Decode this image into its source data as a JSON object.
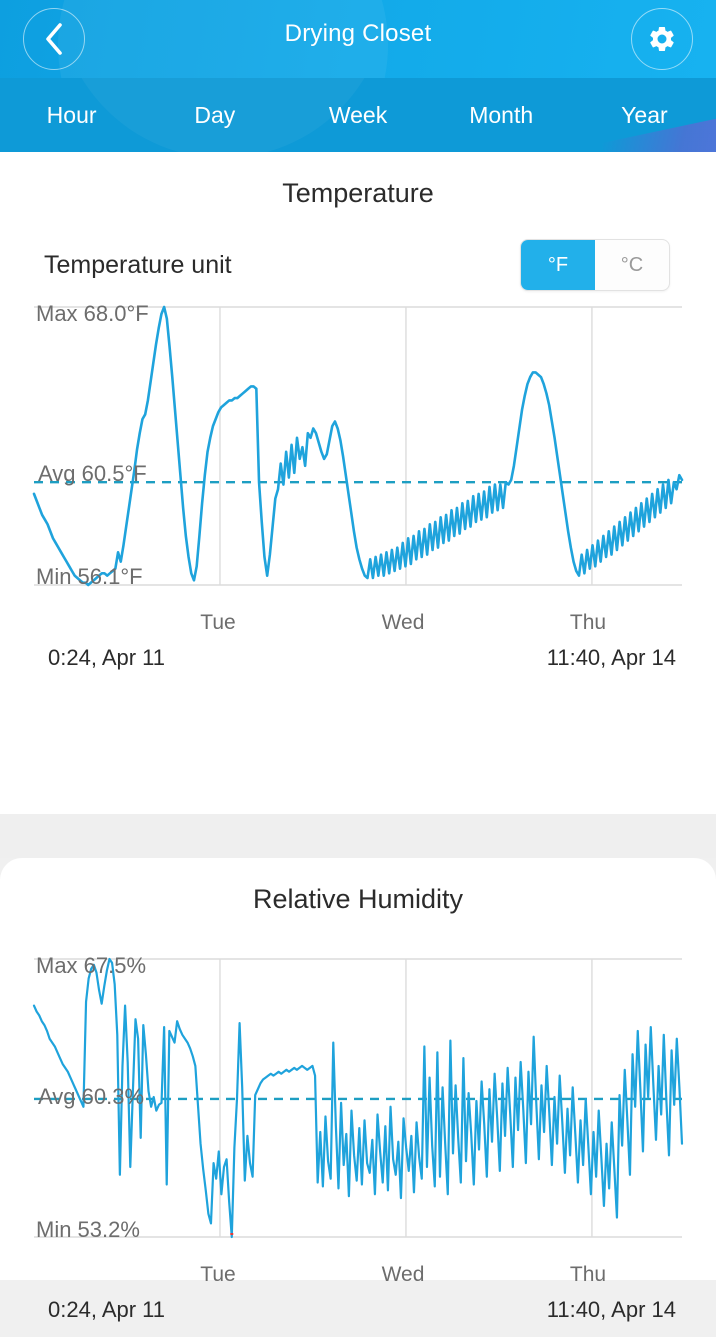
{
  "header": {
    "title": "Drying Closet",
    "back_icon": "chevron-left-icon",
    "settings_icon": "gear-icon"
  },
  "tabs": [
    {
      "label": "Hour",
      "active": false
    },
    {
      "label": "Day",
      "active": true
    },
    {
      "label": "Week",
      "active": false
    },
    {
      "label": "Month",
      "active": false
    },
    {
      "label": "Year",
      "active": false
    }
  ],
  "temperature_card": {
    "title": "Temperature",
    "unit_label": "Temperature unit",
    "unit_options": [
      {
        "label": "°F",
        "selected": true
      },
      {
        "label": "°C",
        "selected": false
      }
    ],
    "max_label": "Max 68.0°F",
    "avg_label": "Avg 60.5°F",
    "min_label": "Min 56.1°F",
    "range_start": "0:24,  Apr 11",
    "range_end": "11:40,  Apr 14",
    "day_ticks": [
      "Tue",
      "Wed",
      "Thu"
    ]
  },
  "humidity_card": {
    "title": "Relative Humidity",
    "max_label": "Max 67.5%",
    "avg_label": "Avg 60.3%",
    "min_label": "Min 53.2%",
    "range_start": "0:24,  Apr 11",
    "range_end": "11:40,  Apr 14",
    "day_ticks": [
      "Tue",
      "Wed",
      "Thu"
    ]
  },
  "colors": {
    "accent": "#22b0ea",
    "line": "#1fa3dc",
    "header_blue": "#12a9e8",
    "tab_blue": "#0e9ad7",
    "alert_red": "#e23b3b",
    "grid": "#dcdcdc"
  },
  "chart_data": [
    {
      "type": "line",
      "title": "Temperature",
      "ylabel": "°F",
      "xlabel": "",
      "grid": true,
      "legend": "none",
      "unit": "°F",
      "ylim": [
        56.1,
        68.0
      ],
      "max": 68.0,
      "avg": 60.5,
      "min": 56.1,
      "avg_line": 60.5,
      "x_start": "0:24, Apr 11",
      "x_end": "11:40, Apr 14",
      "tick_labels": [
        "Tue",
        "Wed",
        "Thu"
      ],
      "tick_positions_frac": [
        0.287,
        0.574,
        0.861
      ],
      "values": [
        60.0,
        59.7,
        59.4,
        59.1,
        58.9,
        58.7,
        58.4,
        58.1,
        57.9,
        57.7,
        57.5,
        57.3,
        57.1,
        56.9,
        56.7,
        56.5,
        56.4,
        56.3,
        56.2,
        56.2,
        56.1,
        56.2,
        56.3,
        56.4,
        56.5,
        56.6,
        56.6,
        56.5,
        56.6,
        56.7,
        56.8,
        57.5,
        57.1,
        57.8,
        58.6,
        59.4,
        60.2,
        61.0,
        61.9,
        62.6,
        63.2,
        63.4,
        64.0,
        64.8,
        65.6,
        66.4,
        67.1,
        67.7,
        68.0,
        67.5,
        66.3,
        65.0,
        63.6,
        62.2,
        60.8,
        59.4,
        58.2,
        57.3,
        56.6,
        56.3,
        56.9,
        58.2,
        59.6,
        60.8,
        61.8,
        62.4,
        62.9,
        63.2,
        63.5,
        63.7,
        63.8,
        63.9,
        64.0,
        64.0,
        64.1,
        64.1,
        64.2,
        64.3,
        64.4,
        64.5,
        64.6,
        64.6,
        64.5,
        60.5,
        58.8,
        57.3,
        56.5,
        57.4,
        58.6,
        59.8,
        60.2,
        61.3,
        60.4,
        61.8,
        60.7,
        62.1,
        60.9,
        62.4,
        61.5,
        62.0,
        61.2,
        62.6,
        62.4,
        62.8,
        62.6,
        62.2,
        61.8,
        61.5,
        61.7,
        62.3,
        62.9,
        63.1,
        62.8,
        62.3,
        61.6,
        60.8,
        60.0,
        59.2,
        58.4,
        57.7,
        57.2,
        56.8,
        56.5,
        56.4,
        57.2,
        56.4,
        57.3,
        56.5,
        57.4,
        56.5,
        57.5,
        56.6,
        57.6,
        56.7,
        57.7,
        56.8,
        57.9,
        56.9,
        58.1,
        57.0,
        58.2,
        57.2,
        58.4,
        57.3,
        58.5,
        57.4,
        58.7,
        57.6,
        58.8,
        57.7,
        59.0,
        57.9,
        59.1,
        58.0,
        59.3,
        58.2,
        59.4,
        58.3,
        59.6,
        58.5,
        59.7,
        58.6,
        59.9,
        58.8,
        60.0,
        58.9,
        60.1,
        59.0,
        60.3,
        59.2,
        60.4,
        59.3,
        60.4,
        59.4,
        60.5,
        60.4,
        60.6,
        61.2,
        62.0,
        62.8,
        63.6,
        64.2,
        64.7,
        65.0,
        65.2,
        65.2,
        65.1,
        65.0,
        64.7,
        64.3,
        63.8,
        63.1,
        62.4,
        61.6,
        60.8,
        60.0,
        59.2,
        58.4,
        57.7,
        57.1,
        56.7,
        56.5,
        57.4,
        56.6,
        57.6,
        56.8,
        57.8,
        56.9,
        58.0,
        57.1,
        58.2,
        57.3,
        58.4,
        57.4,
        58.6,
        57.6,
        58.8,
        57.8,
        59.0,
        58.0,
        59.2,
        58.2,
        59.4,
        58.4,
        59.6,
        58.6,
        59.8,
        58.8,
        60.0,
        59.0,
        60.2,
        59.2,
        60.4,
        59.4,
        60.6,
        59.6,
        60.5,
        60.2,
        60.8,
        60.6
      ]
    },
    {
      "type": "line",
      "title": "Relative Humidity",
      "ylabel": "%",
      "xlabel": "",
      "grid": true,
      "legend": "none",
      "unit": "%",
      "ylim": [
        53.2,
        67.5
      ],
      "max": 67.5,
      "avg": 60.3,
      "min": 53.2,
      "avg_line": 60.3,
      "x_start": "0:24, Apr 11",
      "x_end": "11:40, Apr 14",
      "tick_labels": [
        "Tue",
        "Wed",
        "Thu"
      ],
      "tick_positions_frac": [
        0.287,
        0.574,
        0.861
      ],
      "values": [
        65.1,
        64.8,
        64.6,
        64.3,
        64.1,
        63.8,
        63.4,
        63.2,
        63.0,
        62.7,
        62.4,
        62.1,
        61.9,
        61.7,
        61.4,
        61.1,
        60.8,
        60.5,
        60.2,
        59.9,
        65.3,
        66.5,
        67.0,
        67.2,
        66.8,
        65.9,
        65.2,
        66.1,
        66.9,
        67.5,
        67.3,
        66.2,
        63.6,
        56.4,
        62.0,
        65.1,
        62.2,
        56.8,
        60.7,
        64.4,
        63.4,
        58.3,
        64.1,
        62.6,
        60.7,
        59.9,
        60.4,
        59.7,
        60.0,
        60.1,
        64.0,
        55.9,
        63.8,
        63.5,
        63.2,
        64.3,
        63.9,
        63.6,
        63.4,
        63.2,
        62.9,
        62.5,
        62.0,
        60.0,
        58.0,
        56.7,
        55.6,
        54.4,
        53.9,
        57.0,
        56.2,
        57.6,
        55.4,
        56.8,
        57.2,
        55.0,
        53.2,
        57.8,
        60.3,
        64.2,
        60.9,
        56.1,
        58.4,
        57.0,
        56.3,
        60.5,
        60.8,
        61.1,
        61.3,
        61.4,
        61.5,
        61.6,
        61.5,
        61.6,
        61.7,
        61.6,
        61.7,
        61.8,
        61.7,
        61.8,
        61.9,
        61.8,
        61.9,
        62.0,
        61.9,
        61.8,
        61.9,
        62.0,
        61.5,
        56.0,
        58.6,
        55.8,
        59.4,
        57.1,
        56.2,
        63.2,
        58.9,
        55.7,
        60.1,
        56.9,
        58.5,
        55.3,
        59.7,
        57.4,
        56.1,
        58.8,
        55.9,
        59.2,
        57.0,
        56.5,
        58.2,
        55.4,
        59.5,
        57.6,
        56.0,
        58.9,
        55.6,
        59.9,
        57.2,
        56.4,
        58.1,
        55.2,
        59.3,
        57.8,
        56.6,
        58.4,
        55.5,
        59.1,
        57.3,
        56.2,
        63.0,
        56.8,
        61.4,
        57.9,
        55.8,
        62.7,
        56.3,
        60.9,
        58.0,
        55.4,
        63.3,
        57.5,
        61.0,
        58.3,
        56.0,
        62.4,
        57.1,
        60.6,
        58.5,
        55.9,
        60.2,
        57.7,
        61.2,
        59.0,
        56.3,
        60.8,
        58.1,
        61.6,
        59.3,
        56.6,
        61.1,
        58.4,
        61.9,
        59.5,
        56.8,
        61.4,
        58.7,
        62.2,
        59.8,
        57.0,
        61.7,
        59.0,
        63.5,
        60.1,
        57.2,
        61.0,
        58.6,
        62.0,
        59.6,
        56.9,
        60.4,
        58.0,
        61.5,
        59.1,
        56.5,
        59.8,
        57.4,
        60.9,
        58.5,
        56.0,
        59.2,
        56.9,
        60.3,
        57.9,
        55.4,
        58.6,
        56.3,
        59.7,
        57.3,
        54.8,
        58.0,
        55.7,
        59.1,
        56.7,
        54.2,
        60.5,
        57.9,
        61.8,
        59.2,
        56.4,
        62.6,
        59.9,
        63.8,
        60.8,
        57.6,
        63.1,
        60.4,
        64.0,
        61.0,
        58.2,
        62.0,
        59.5,
        63.6,
        60.2,
        57.4,
        62.8,
        60.0,
        63.4,
        60.9,
        58.0
      ]
    }
  ]
}
